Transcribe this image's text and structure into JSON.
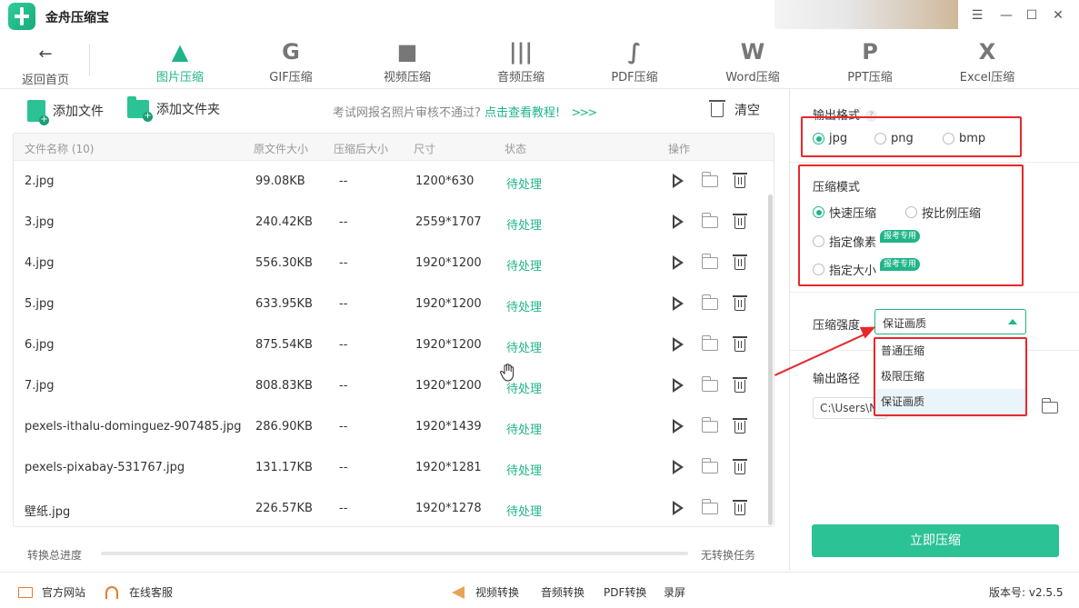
{
  "app": {
    "title": "金舟压缩宝"
  },
  "topnav": {
    "back_label": "返回首页",
    "items": [
      {
        "label": "图片压缩",
        "icon": "image-compress-icon",
        "active": true
      },
      {
        "label": "GIF压缩",
        "icon": "gif-icon",
        "active": false
      },
      {
        "label": "视频压缩",
        "icon": "video-icon",
        "active": false
      },
      {
        "label": "音频压缩",
        "icon": "audio-icon",
        "active": false
      },
      {
        "label": "PDF压缩",
        "icon": "pdf-icon",
        "active": false
      },
      {
        "label": "Word压缩",
        "icon": "word-icon",
        "active": false
      },
      {
        "label": "PPT压缩",
        "icon": "ppt-icon",
        "active": false
      },
      {
        "label": "Excel压缩",
        "icon": "excel-icon",
        "active": false
      }
    ]
  },
  "toolbar": {
    "add_file": "添加文件",
    "add_folder": "添加文件夹",
    "tip_text": "考试网报名照片审核不通过?",
    "tip_link": "点击查看教程!",
    "tip_arrows": ">>>",
    "clear": "清空"
  },
  "table": {
    "headers": {
      "name": "文件名称 (10)",
      "original_size": "原文件大小",
      "compressed_size": "压缩后大小",
      "dimensions": "尺寸",
      "status": "状态",
      "actions": "操作"
    },
    "rows": [
      {
        "name": "2.jpg",
        "size": "99.08KB",
        "compressed": "--",
        "dim": "1200*630",
        "status": "待处理"
      },
      {
        "name": "3.jpg",
        "size": "240.42KB",
        "compressed": "--",
        "dim": "2559*1707",
        "status": "待处理"
      },
      {
        "name": "4.jpg",
        "size": "556.30KB",
        "compressed": "--",
        "dim": "1920*1200",
        "status": "待处理"
      },
      {
        "name": "5.jpg",
        "size": "633.95KB",
        "compressed": "--",
        "dim": "1920*1200",
        "status": "待处理"
      },
      {
        "name": "6.jpg",
        "size": "875.54KB",
        "compressed": "--",
        "dim": "1920*1200",
        "status": "待处理"
      },
      {
        "name": "7.jpg",
        "size": "808.83KB",
        "compressed": "--",
        "dim": "1920*1200",
        "status": "待处理"
      },
      {
        "name": "pexels-ithalu-dominguez-907485.jpg",
        "size": "286.90KB",
        "compressed": "--",
        "dim": "1920*1439",
        "status": "待处理"
      },
      {
        "name": "pexels-pixabay-531767.jpg",
        "size": "131.17KB",
        "compressed": "--",
        "dim": "1920*1281",
        "status": "待处理"
      },
      {
        "name": "壁纸.jpg",
        "size": "226.57KB",
        "compressed": "--",
        "dim": "1920*1278",
        "status": "待处理"
      }
    ]
  },
  "progress": {
    "label": "转换总进度",
    "status": "无转换任务",
    "value": 0
  },
  "settings": {
    "output_format": {
      "title": "输出格式",
      "options": [
        "jpg",
        "png",
        "bmp"
      ],
      "selected": "jpg"
    },
    "compress_mode": {
      "title": "压缩模式",
      "options": [
        "快速压缩",
        "按比例压缩",
        "指定像素",
        "指定大小"
      ],
      "selected": "快速压缩",
      "badge": "报考专用"
    },
    "strength": {
      "title": "压缩强度",
      "value": "保证画质",
      "options": [
        "普通压缩",
        "极限压缩",
        "保证画质"
      ]
    },
    "output_path": {
      "title": "输出路径",
      "value": "C:\\Users\\N"
    },
    "compress_button": "立即压缩"
  },
  "footer": {
    "website": "官方网站",
    "service": "在线客服",
    "video_convert": "视频转换",
    "audio_convert": "音频转换",
    "pdf_convert": "PDF转换",
    "record": "录屏",
    "version": "版本号: v2.5.5"
  },
  "colors": {
    "accent": "#1fb589",
    "button": "#2bc295",
    "annotation": "#e8282b"
  }
}
